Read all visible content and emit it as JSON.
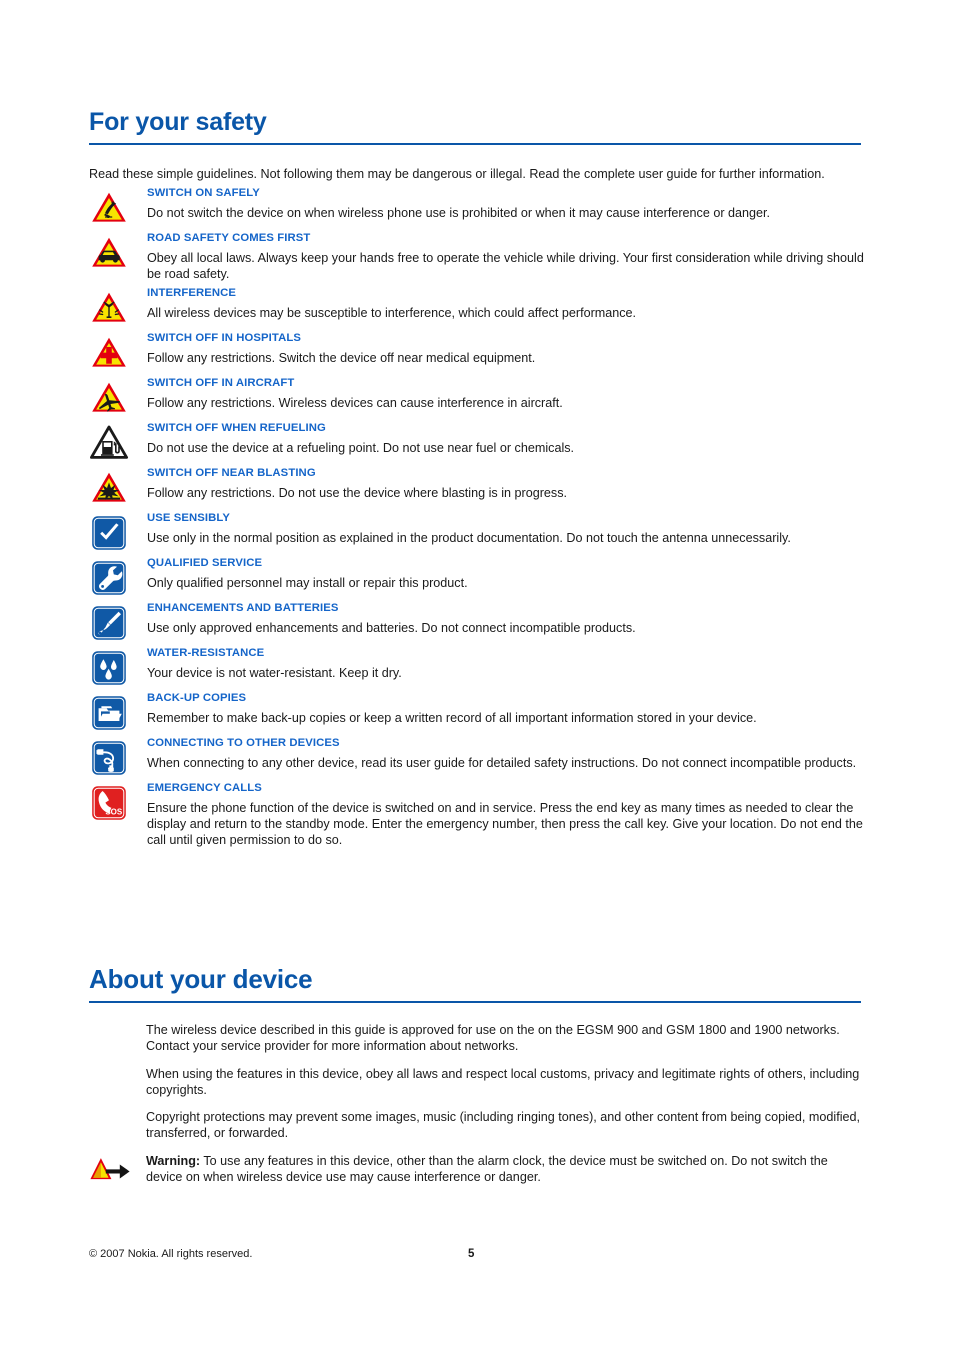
{
  "document": {
    "sections": [
      {
        "id": "safety",
        "title": "For your safety"
      },
      {
        "id": "about",
        "title": "About your device"
      }
    ],
    "intro": "Read these simple guidelines. Not following them may be dangerous or illegal. Read the complete user guide for further information.",
    "safety_items": [
      {
        "icon": "warning-triangle-switch-on-icon",
        "title": "SWITCH ON SAFELY",
        "body": "Do not switch the device on when wireless phone use is prohibited or when it may cause interference or danger."
      },
      {
        "icon": "warning-triangle-car-icon",
        "title": "ROAD SAFETY COMES FIRST",
        "body": "Obey all local laws. Always keep your hands free to operate the vehicle while driving. Your first consideration while driving should be road safety."
      },
      {
        "icon": "warning-triangle-interference-icon",
        "title": "INTERFERENCE",
        "body": "All wireless devices may be susceptible to interference, which could affect performance."
      },
      {
        "icon": "warning-triangle-hospital-cross-icon",
        "title": "SWITCH OFF IN HOSPITALS",
        "body": "Follow any restrictions. Switch the device off near medical equipment."
      },
      {
        "icon": "warning-triangle-aircraft-icon",
        "title": "SWITCH OFF IN AIRCRAFT",
        "body": "Follow any restrictions. Wireless devices can cause interference in aircraft."
      },
      {
        "icon": "warning-triangle-fuel-pump-icon",
        "title": "SWITCH OFF WHEN REFUELING",
        "body": "Do not use the device at a refueling point. Do not use near fuel or chemicals."
      },
      {
        "icon": "warning-triangle-blasting-icon",
        "title": "SWITCH OFF NEAR BLASTING",
        "body": "Follow any restrictions. Do not use the device where blasting is in progress."
      },
      {
        "icon": "blue-checkmark-icon",
        "title": "USE SENSIBLY",
        "body": "Use only in the normal position as explained in the product documentation. Do not touch the antenna unnecessarily."
      },
      {
        "icon": "blue-wrench-icon",
        "title": "QUALIFIED SERVICE",
        "body": "Only qualified personnel may install or repair this product."
      },
      {
        "icon": "blue-battery-probe-icon",
        "title": "ENHANCEMENTS AND BATTERIES",
        "body": "Use only approved enhancements and batteries. Do not connect incompatible products."
      },
      {
        "icon": "blue-water-drops-icon",
        "title": "WATER-RESISTANCE",
        "body": "Your device is not water-resistant. Keep it dry."
      },
      {
        "icon": "blue-folder-backup-icon",
        "title": "BACK-UP COPIES",
        "body": "Remember to make back-up copies or keep a written record of all important information stored in your device."
      },
      {
        "icon": "blue-connector-cable-icon",
        "title": "CONNECTING TO OTHER DEVICES",
        "body": "When connecting to any other device, read its user guide for detailed safety instructions. Do not connect incompatible products."
      },
      {
        "icon": "red-sos-phone-icon",
        "title": "EMERGENCY CALLS",
        "body": "Ensure the phone function of the device is switched on and in service. Press the end key as many times as needed to clear the display and return to the standby mode. Enter the emergency number, then press the call key. Give your location. Do not end the call until given permission to do so."
      }
    ],
    "about_paragraphs": [
      "The wireless device described in this guide is approved for use on the on the EGSM 900 and GSM 1800 and 1900 networks. Contact your service provider for more information about networks.",
      "When using the features in this device, obey all laws and respect local customs, privacy and legitimate rights of others, including copyrights.",
      "Copyright protections may prevent some images, music (including ringing tones), and other content from being copied, modified, transferred, or forwarded."
    ],
    "warning": {
      "icon": "warning-arrow-icon",
      "label": "Warning:",
      "text": " To use any features in this device, other than the alarm clock, the device must be switched on. Do not switch the device on when wireless device use may cause interference or danger."
    },
    "footer": {
      "copyright": "© 2007 Nokia. All rights reserved.",
      "page_number": "5"
    },
    "colors": {
      "heading_blue": "#0a56a8",
      "subheading_blue": "#1565c9",
      "warning_yellow": "#f7e400",
      "warning_red": "#e3000f",
      "icon_blue": "#1059a6",
      "sos_red": "#e02020",
      "text": "#1a1a1a"
    }
  }
}
